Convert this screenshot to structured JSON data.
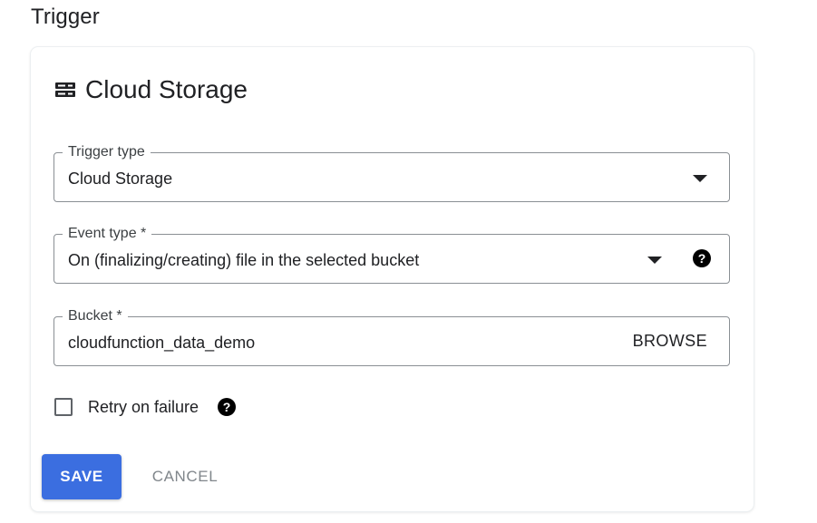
{
  "section": {
    "title": "Trigger"
  },
  "card": {
    "icon": "storage-icon",
    "title": "Cloud Storage"
  },
  "fields": {
    "trigger_type": {
      "label": "Trigger type",
      "value": "Cloud Storage",
      "icon": "chevron-down-icon"
    },
    "event_type": {
      "label": "Event type *",
      "value": "On (finalizing/creating) file in the selected bucket",
      "icon": "chevron-down-icon",
      "help_icon": "help-icon",
      "help_glyph": "?"
    },
    "bucket": {
      "label": "Bucket *",
      "value": "cloudfunction_data_demo",
      "browse_label": "BROWSE"
    }
  },
  "retry": {
    "label": "Retry on failure",
    "checked": false,
    "help_icon": "help-icon",
    "help_glyph": "?"
  },
  "actions": {
    "save_label": "SAVE",
    "cancel_label": "CANCEL"
  },
  "colors": {
    "primary": "#3b6ee0",
    "text": "#202124",
    "muted": "#80868b",
    "border": "#8a8f94"
  }
}
